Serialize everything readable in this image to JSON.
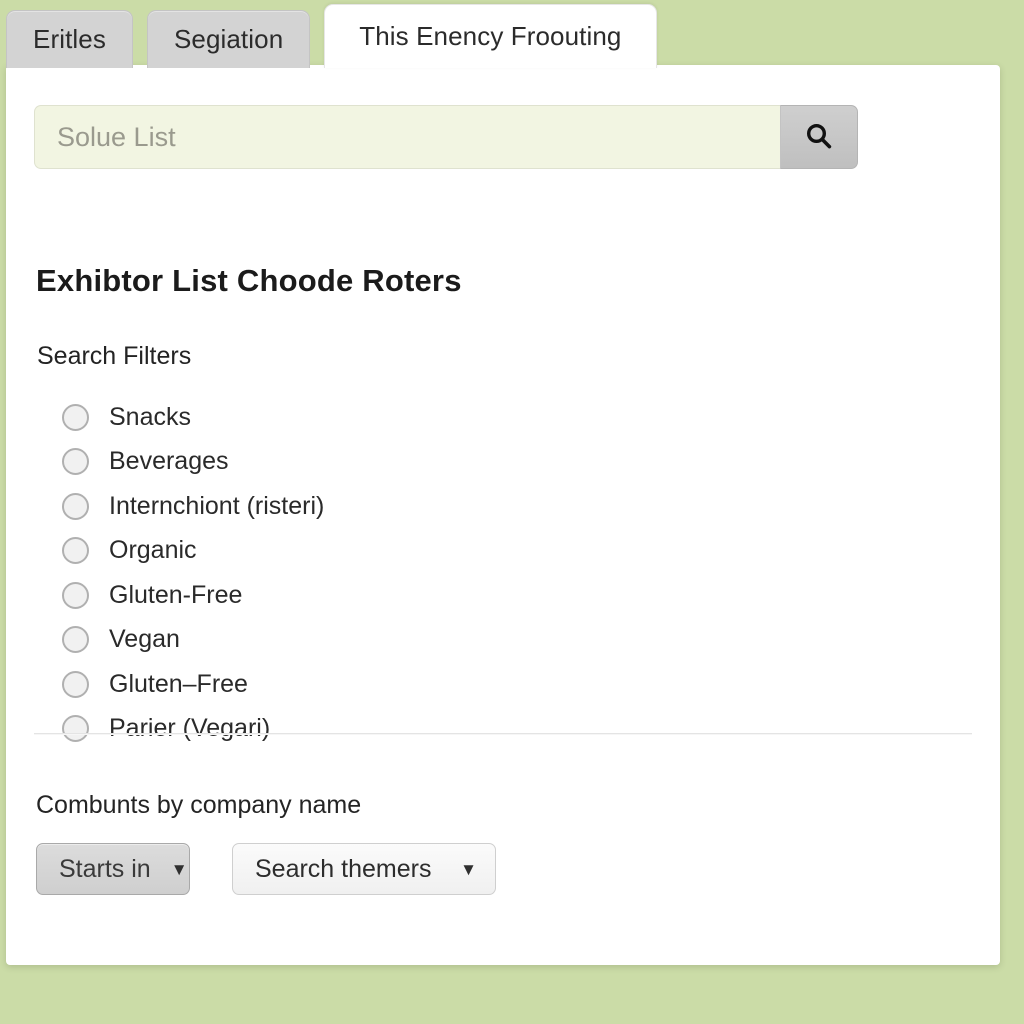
{
  "page": {
    "background_color": "#cbdca7",
    "card_background": "#ffffff"
  },
  "tabs": [
    {
      "label": "Eritles",
      "active": false
    },
    {
      "label": "Segiation",
      "active": false
    },
    {
      "label": "This Enency Froouting",
      "active": true
    }
  ],
  "search": {
    "placeholder": "Solue List",
    "value": "",
    "button_icon": "search-icon",
    "input_background": "#f2f5e2"
  },
  "headings": {
    "page_title": "Exhibtor List Choode Roters",
    "section_title": "Search Filters"
  },
  "filters": [
    {
      "label": "Snacks",
      "selected": false
    },
    {
      "label": "Beverages",
      "selected": false
    },
    {
      "label": "Internchiont (risteri)",
      "selected": false
    },
    {
      "label": "Organic",
      "selected": false
    },
    {
      "label": "Gluten-Free",
      "selected": false
    },
    {
      "label": "Vegan",
      "selected": false
    },
    {
      "label": "Gluten–Free",
      "selected": false
    },
    {
      "label": "Parier (Vegari)",
      "selected": false
    }
  ],
  "bottom": {
    "label": "Combunts by company name",
    "match_select": {
      "value": "Starts in",
      "caret_icon": "chevron-down-icon"
    },
    "theme_select": {
      "value": "Search themers",
      "caret_icon": "chevron-down-icon"
    }
  }
}
